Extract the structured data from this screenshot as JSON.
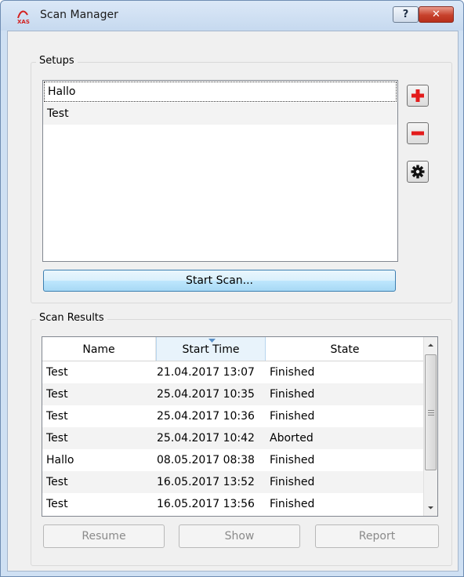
{
  "window": {
    "title": "Scan Manager",
    "help_label": "?",
    "close_label": "✕"
  },
  "setups": {
    "group_title": "Setups",
    "items": [
      {
        "label": "Hallo",
        "selected": true
      },
      {
        "label": "Test",
        "selected": false
      }
    ],
    "start_scan_label": "Start Scan...",
    "icons": [
      "plus-icon",
      "minus-icon",
      "gear-icon"
    ],
    "accent_color": "#e31b1b"
  },
  "results": {
    "group_title": "Scan Results",
    "columns": [
      "Name",
      "Start Time",
      "State"
    ],
    "sorted_column": "Start Time",
    "rows": [
      {
        "name": "Test",
        "start": "21.04.2017 13:07",
        "state": "Finished"
      },
      {
        "name": "Test",
        "start": "25.04.2017 10:35",
        "state": "Finished"
      },
      {
        "name": "Test",
        "start": "25.04.2017 10:36",
        "state": "Finished"
      },
      {
        "name": "Test",
        "start": "25.04.2017 10:42",
        "state": "Aborted"
      },
      {
        "name": "Hallo",
        "start": "08.05.2017 08:38",
        "state": "Finished"
      },
      {
        "name": "Test",
        "start": "16.05.2017 13:52",
        "state": "Finished"
      },
      {
        "name": "Test",
        "start": "16.05.2017 13:56",
        "state": "Finished"
      }
    ],
    "buttons": {
      "resume": "Resume",
      "show": "Show",
      "report": "Report"
    }
  }
}
